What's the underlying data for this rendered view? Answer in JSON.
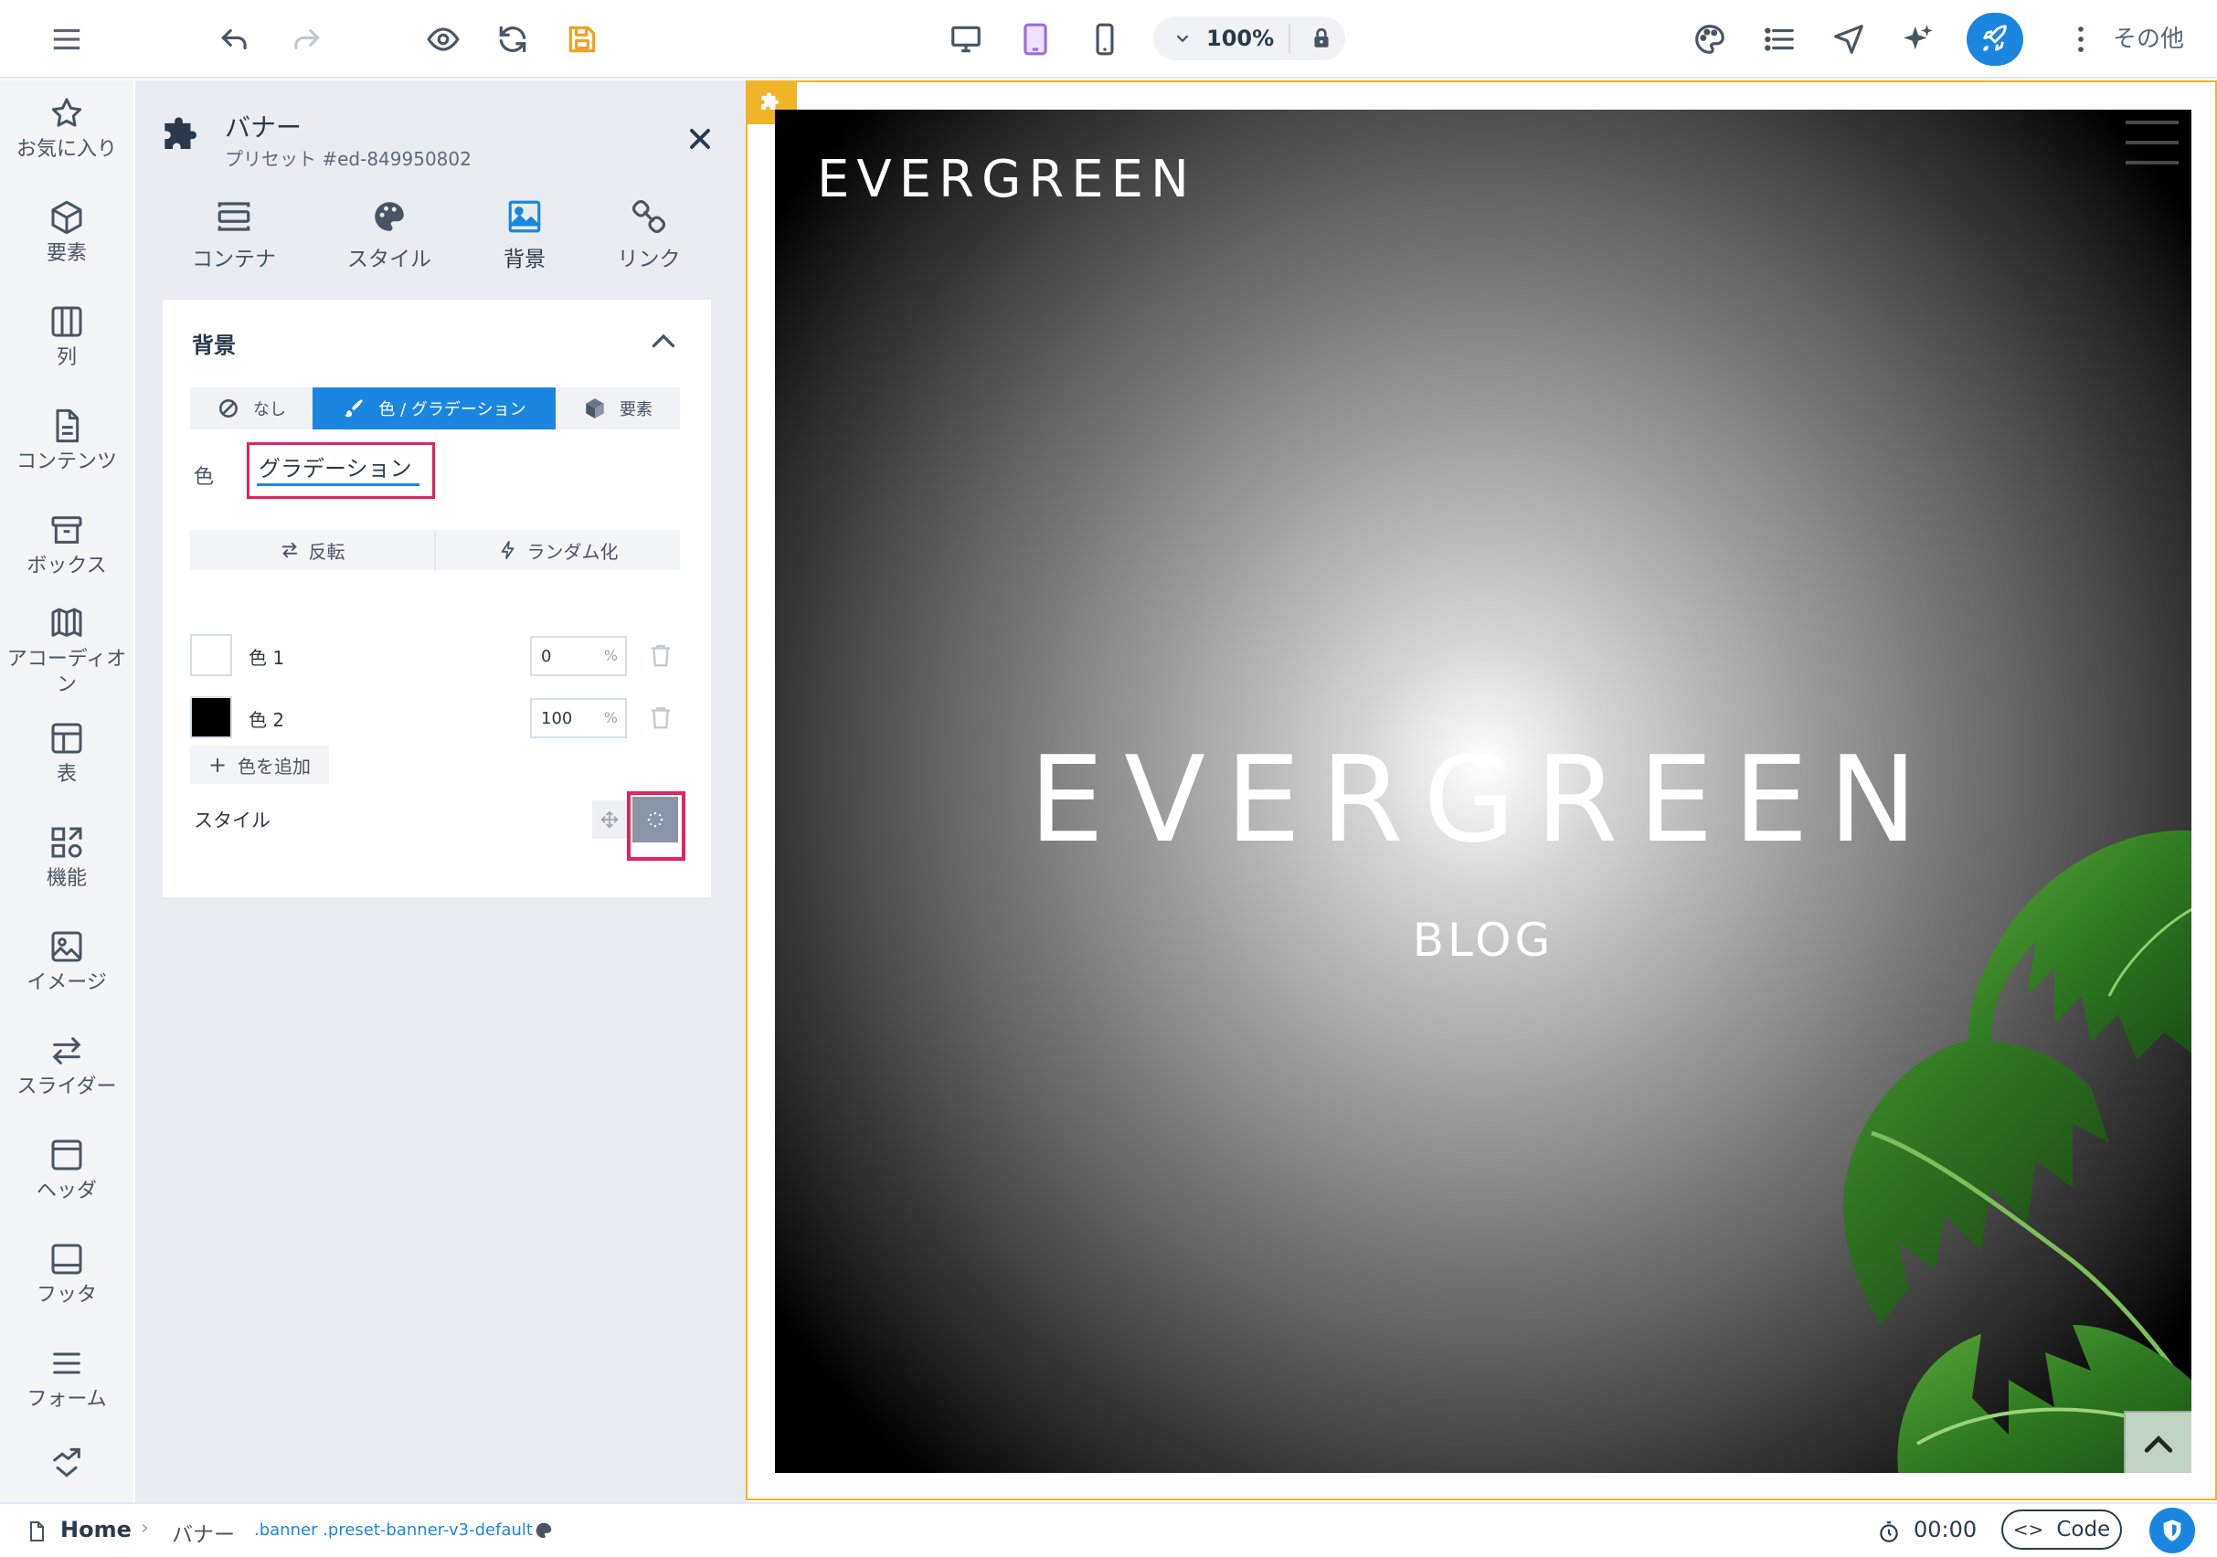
{
  "toolbar": {
    "zoom": "100%",
    "more_label": "その他",
    "icons": [
      "menu-icon",
      "undo-icon",
      "redo-icon",
      "preview-eye-icon",
      "refresh-icon",
      "save-icon",
      "desktop-icon",
      "tablet-icon",
      "mobile-icon",
      "chevron-down-icon",
      "lock-icon",
      "palette-icon",
      "list-icon",
      "navigate-icon",
      "ai-sparkle-icon",
      "rocket-icon",
      "more-vertical-icon"
    ]
  },
  "rail": {
    "items": [
      {
        "label": "お気に入り",
        "icon": "star-icon"
      },
      {
        "label": "要素",
        "icon": "cube-icon"
      },
      {
        "label": "列",
        "icon": "columns-icon"
      },
      {
        "label": "コンテンツ",
        "icon": "document-icon"
      },
      {
        "label": "ボックス",
        "icon": "box-icon"
      },
      {
        "label": "アコーディオン",
        "icon": "accordion-icon"
      },
      {
        "label": "表",
        "icon": "table-icon"
      },
      {
        "label": "機能",
        "icon": "features-icon"
      },
      {
        "label": "イメージ",
        "icon": "image-icon"
      },
      {
        "label": "スライダー",
        "icon": "slider-icon"
      },
      {
        "label": "ヘッダ",
        "icon": "header-icon"
      },
      {
        "label": "フッタ",
        "icon": "footer-icon"
      },
      {
        "label": "フォーム",
        "icon": "form-icon"
      }
    ]
  },
  "panel": {
    "title": "バナー",
    "subtitle": "プリセット #ed-849950802",
    "tabs": [
      {
        "label": "コンテナ",
        "icon": "container-icon"
      },
      {
        "label": "スタイル",
        "icon": "palette-icon"
      },
      {
        "label": "背景",
        "icon": "image-icon"
      },
      {
        "label": "リンク",
        "icon": "link-icon"
      }
    ],
    "active_tab": "背景",
    "section": {
      "title": "背景",
      "modes": [
        {
          "label": "なし",
          "icon": "ban-icon"
        },
        {
          "label": "色 / グラデーション",
          "icon": "brush-icon"
        },
        {
          "label": "要素",
          "icon": "cube-icon"
        }
      ],
      "color_label": "色",
      "color_value": "グラデーション",
      "reverse_label": "反転",
      "randomize_label": "ランダム化",
      "stops": [
        {
          "label": "色 1",
          "color": "#ffffff",
          "value": "0",
          "unit": "%"
        },
        {
          "label": "色 2",
          "color": "#000000",
          "value": "100",
          "unit": "%"
        }
      ],
      "add_color_label": "色を追加",
      "style_label": "スタイル"
    }
  },
  "canvas": {
    "logo": "EVERGREEN",
    "hero_title": "EVERGREEN",
    "hero_subtitle": "BLOG"
  },
  "statusbar": {
    "home": "Home",
    "element": "バナー",
    "classes": ".banner .preset-banner-v3-default",
    "timer": "00:00",
    "code_label": "Code"
  },
  "colors": {
    "accent": "#1a86e0",
    "highlight": "#e0245e",
    "canvas_border": "#f0b429",
    "tablet_active": "#9b6ce0",
    "save_orange": "#f0a020"
  }
}
